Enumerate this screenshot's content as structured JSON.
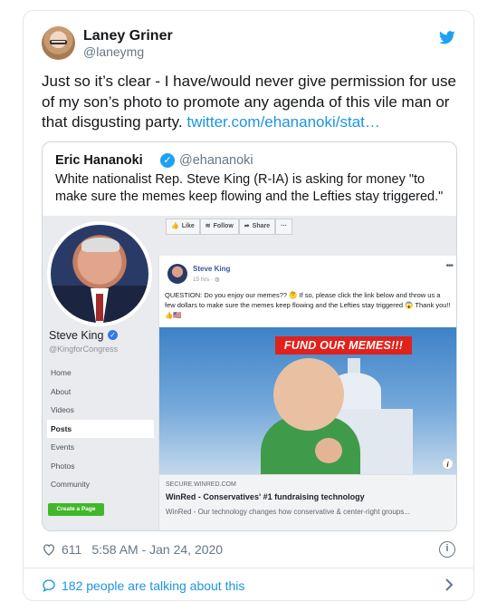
{
  "tweet": {
    "author_name": "Laney Griner",
    "author_handle": "@laneymg",
    "text": "Just so it’s clear - I have/would never give permission for use of my son’s photo to promote any agenda of this vile man or that disgusting party.",
    "link": "twitter.com/ehananoki/stat…",
    "likes": "611",
    "timestamp": "5:58 AM - Jan 24, 2020",
    "talking": "182 people are talking about this"
  },
  "quote": {
    "name": "Eric Hananoki",
    "handle": "@ehananoki",
    "text": "White nationalist Rep. Steve King (R-IA) is asking for money \"to make sure the memes keep flowing and the Lefties stay triggered.\""
  },
  "fb": {
    "page_name": "Steve King",
    "page_handle": "@KingforCongress",
    "nav": [
      "Home",
      "About",
      "Videos",
      "Posts",
      "Events",
      "Photos",
      "Community"
    ],
    "active_nav": "Posts",
    "create_page": "Create a Page",
    "actions": [
      "Like",
      "Follow",
      "Share",
      "···"
    ],
    "post": {
      "name": "Steve King",
      "time": "15 hrs · ◍",
      "text": "QUESTION: Do you enjoy our memes?? 🤔 If so, please click the link below and throw us a few dollars to make sure the memes keep flowing and the Lefties stay triggered 😱 Thank you!! 👍🇺🇸",
      "more": "•••",
      "banner": "FUND OUR MEMES!!!",
      "info": "i",
      "link_domain": "SECURE.WINRED.COM",
      "link_title": "WinRed - Conservatives' #1 fundraising technology",
      "link_desc": "WinRed - Our technology changes how conservative & center-right groups..."
    }
  },
  "colors": {
    "link": "#1b95e0",
    "twitter_blue": "#1da1f2",
    "banner_red": "#e0211c",
    "fb_green": "#42b72a"
  },
  "icons": [
    "twitter-bird-icon",
    "verified-icon",
    "heart-icon",
    "info-icon",
    "speech-bubble-icon",
    "chevron-right-icon"
  ]
}
